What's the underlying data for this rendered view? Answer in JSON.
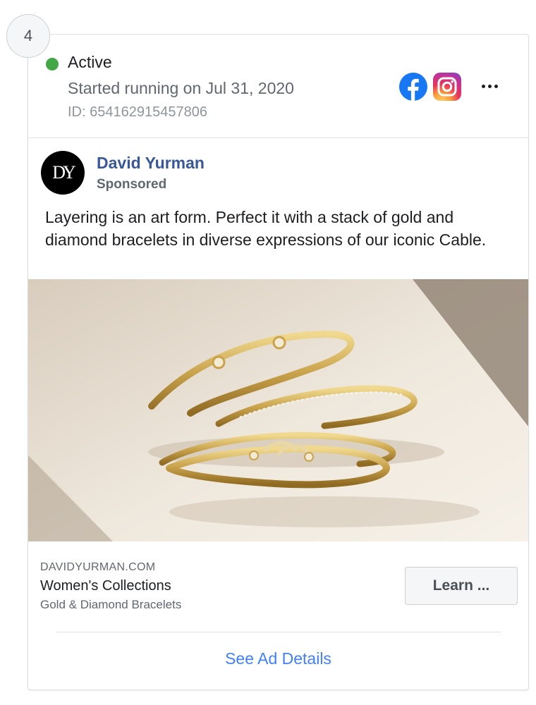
{
  "index": "4",
  "status": {
    "label": "Active",
    "started": "Started running on Jul 31, 2020",
    "id": "ID: 654162915457806",
    "dot_color": "#42a846"
  },
  "platforms": [
    "facebook-icon",
    "instagram-icon"
  ],
  "post": {
    "page_name": "David Yurman",
    "avatar_text": "DY",
    "sponsored": "Sponsored",
    "body": "Layering is an art form. Perfect it with a stack of gold and diamond bracelets in diverse expressions of our iconic Cable."
  },
  "link": {
    "domain": "DAVIDYURMAN.COM",
    "title": "Women's Collections",
    "description": "Gold & Diamond Bracelets",
    "cta": "Learn ..."
  },
  "footer": {
    "details_link": "See Ad Details"
  },
  "colors": {
    "page_name": "#385898",
    "link": "#4080ff",
    "facebook": "#1877f2"
  }
}
